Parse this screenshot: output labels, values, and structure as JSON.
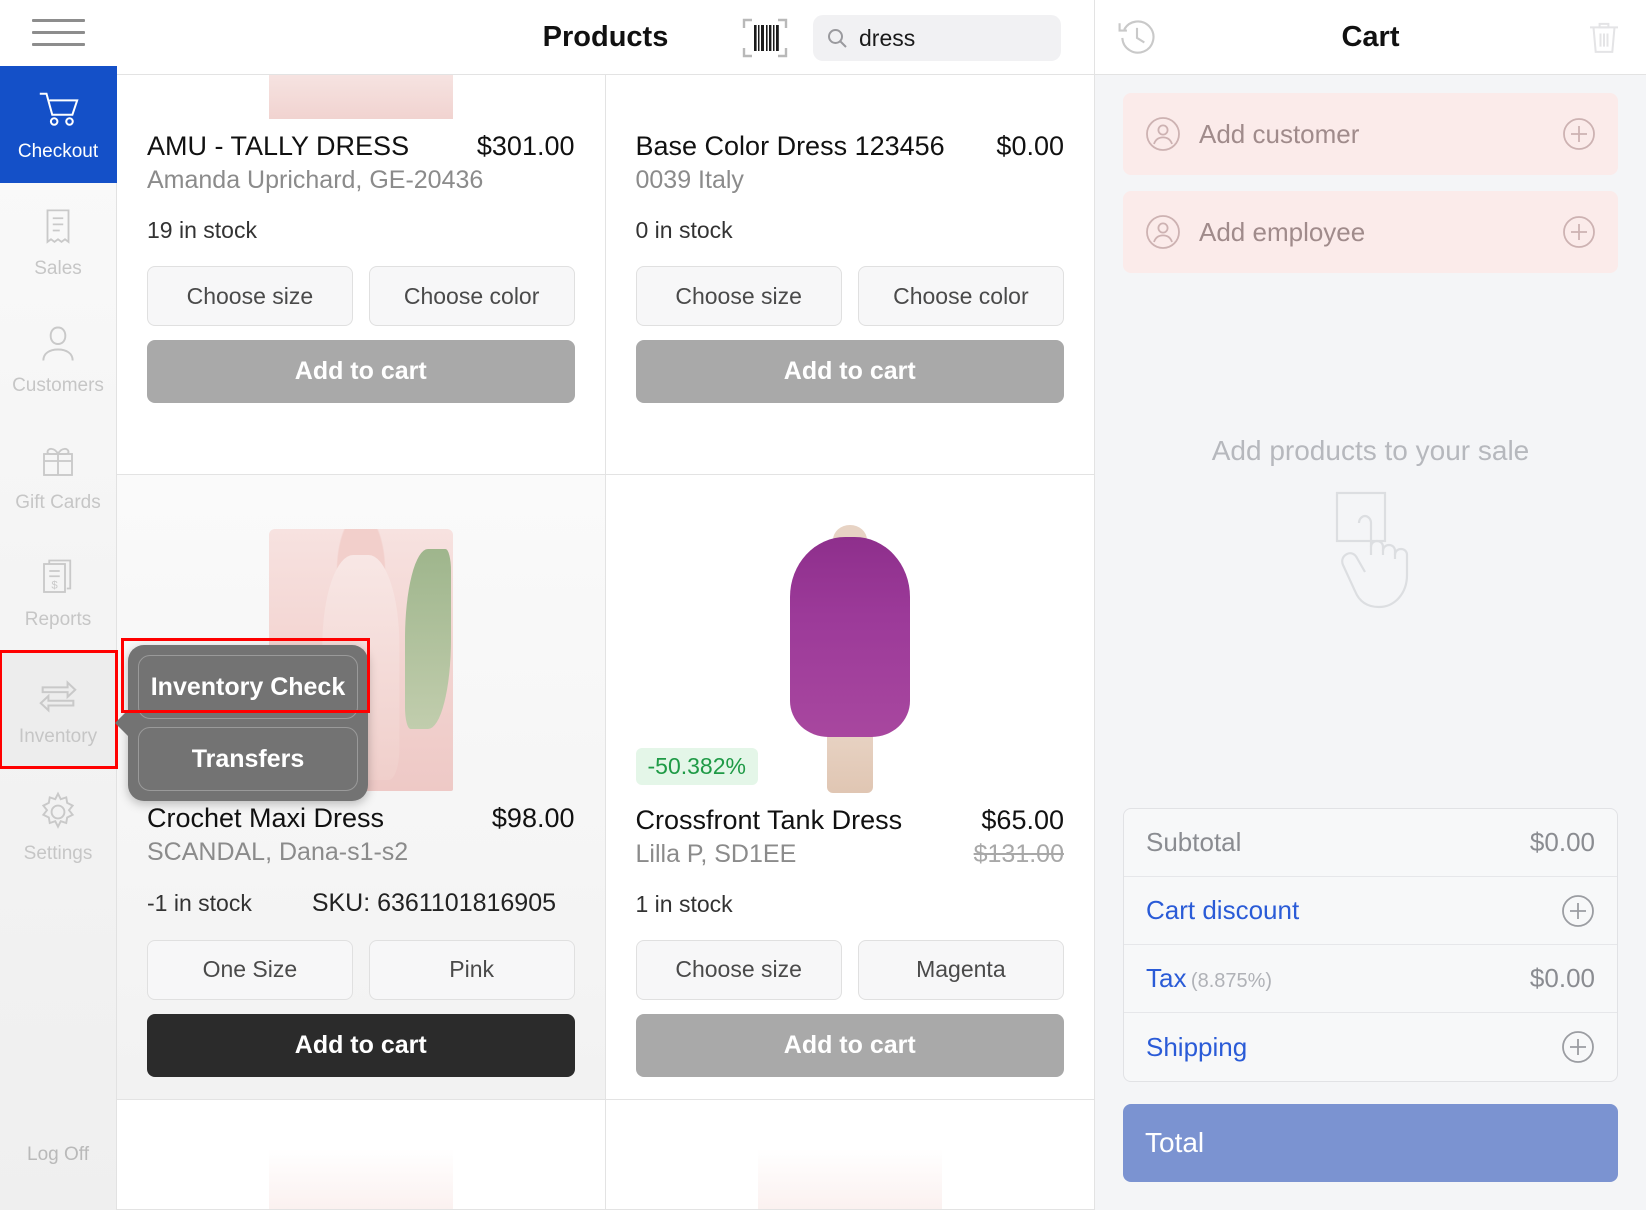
{
  "sidebar": {
    "menu_icon": "hamburger-icon",
    "items": [
      {
        "label": "Checkout",
        "icon": "cart-icon",
        "active": true
      },
      {
        "label": "Sales",
        "icon": "receipt-icon",
        "active": false
      },
      {
        "label": "Customers",
        "icon": "person-icon",
        "active": false
      },
      {
        "label": "Gift Cards",
        "icon": "gift-icon",
        "active": false
      },
      {
        "label": "Reports",
        "icon": "report-icon",
        "active": false
      },
      {
        "label": "Inventory",
        "icon": "transfer-icon",
        "active": false
      },
      {
        "label": "Settings",
        "icon": "gear-icon",
        "active": false
      }
    ],
    "log_off": "Log Off",
    "active_color": "#1450c8",
    "highlight_color": "#ff0000"
  },
  "popover": {
    "items": [
      {
        "label": "Inventory Check"
      },
      {
        "label": "Transfers"
      }
    ]
  },
  "products_header": {
    "title": "Products",
    "barcode_icon": "barcode-scan-icon",
    "search": {
      "icon": "search-icon",
      "value": "dress",
      "placeholder": "Search products",
      "clear_icon": "clear-icon"
    }
  },
  "products": [
    {
      "name": "AMU - TALLY DRESS",
      "price": "$301.00",
      "compare_price": "",
      "vendor": "Amanda Uprichard, GE-20436",
      "stock": "19 in stock",
      "sku": "",
      "discount_badge": "",
      "size_option": "Choose size",
      "color_option": "Choose color",
      "add_label": "Add to cart",
      "add_enabled": false
    },
    {
      "name": "Base Color Dress 123456",
      "price": "$0.00",
      "compare_price": "",
      "vendor": "0039 Italy",
      "stock": "0 in stock",
      "sku": "",
      "discount_badge": "",
      "size_option": "Choose size",
      "color_option": "Choose color",
      "add_label": "Add to cart",
      "add_enabled": false
    },
    {
      "name": "Crochet Maxi Dress",
      "price": "$98.00",
      "compare_price": "",
      "vendor": "SCANDAL, Dana-s1-s2",
      "stock": "-1 in stock",
      "sku": "SKU: 6361101816905",
      "discount_badge": "",
      "size_option": "One Size",
      "color_option": "Pink",
      "add_label": "Add to cart",
      "add_enabled": true
    },
    {
      "name": "Crossfront Tank Dress",
      "price": "$65.00",
      "compare_price": "$131.00",
      "vendor": "Lilla P, SD1EE",
      "stock": "1 in stock",
      "sku": "",
      "discount_badge": "-50.382%",
      "size_option": "Choose size",
      "color_option": "Magenta",
      "add_label": "Add to cart",
      "add_enabled": false
    }
  ],
  "cart": {
    "title": "Cart",
    "history_icon": "history-icon",
    "trash_icon": "trash-icon",
    "add_customer": "Add customer",
    "add_employee": "Add employee",
    "customer_icon": "person-circle-icon",
    "employee_icon": "person-circle-icon",
    "plus_icon": "plus-circle-icon",
    "empty_text": "Add products to your sale",
    "empty_icon": "tap-hand-icon",
    "totals": [
      {
        "label": "Subtotal",
        "sublabel": "",
        "value": "$0.00",
        "link": false,
        "has_plus": false
      },
      {
        "label": "Cart discount",
        "sublabel": "",
        "value": "",
        "link": true,
        "has_plus": true
      },
      {
        "label": "Tax",
        "sublabel": "(8.875%)",
        "value": "$0.00",
        "link": true,
        "has_plus": false
      },
      {
        "label": "Shipping",
        "sublabel": "",
        "value": "",
        "link": true,
        "has_plus": true
      }
    ],
    "total_label": "Total",
    "total_color": "#7b93d1"
  }
}
